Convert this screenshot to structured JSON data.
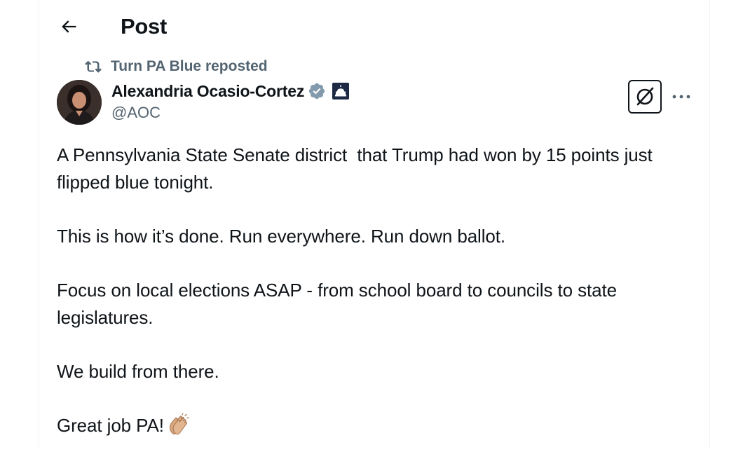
{
  "header": {
    "title": "Post",
    "back_icon": "arrow-left-icon"
  },
  "repost": {
    "icon": "repost-icon",
    "text": "Turn PA Blue reposted"
  },
  "author": {
    "name": "Alexandria Ocasio-Cortez",
    "handle": "@AOC",
    "verified_icon": "verified-badge-icon",
    "verified_color": "#829aab",
    "affiliation_badge": "capitol-building-icon"
  },
  "actions": {
    "grok_icon": "grok-icon",
    "more_icon": "more-horizontal-icon"
  },
  "post": {
    "paragraphs": [
      "A Pennsylvania State Senate district  that Trump had won by 15 points just flipped blue tonight.",
      "This is how it’s done. Run everywhere. Run down ballot.",
      "Focus on local elections ASAP - from school board to councils to state legislatures.",
      "We build from there.",
      "Great job PA!"
    ],
    "emoji": "clapping-hands-emoji"
  },
  "colors": {
    "text_primary": "#0f1419",
    "text_secondary": "#536471",
    "border": "#eff3f4"
  }
}
